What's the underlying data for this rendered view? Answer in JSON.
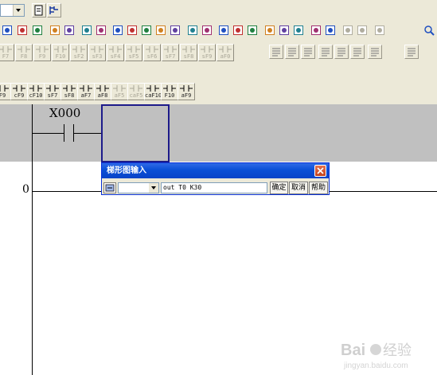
{
  "toolbar": {
    "row1_icons": [
      "combo-box",
      "select-icon",
      "monitor-icon"
    ],
    "fkeys_row2": [
      {
        "cap": "F7",
        "enabled": false
      },
      {
        "cap": "F8",
        "enabled": false
      },
      {
        "cap": "F9",
        "enabled": false
      },
      {
        "cap": "F10",
        "enabled": false
      },
      {
        "cap": "sF2",
        "enabled": false
      },
      {
        "cap": "sF3",
        "enabled": false
      },
      {
        "cap": "sF4",
        "enabled": false
      },
      {
        "cap": "sF5",
        "enabled": false
      },
      {
        "cap": "sF6",
        "enabled": false
      },
      {
        "cap": "sF7",
        "enabled": false
      },
      {
        "cap": "sF8",
        "enabled": false
      },
      {
        "cap": "sF9",
        "enabled": false
      },
      {
        "cap": "aF0",
        "enabled": false
      }
    ],
    "fkeys_row3": [
      {
        "cap": "F9",
        "enabled": true
      },
      {
        "cap": "cF9",
        "enabled": true
      },
      {
        "cap": "cF10",
        "enabled": true
      },
      {
        "cap": "sF7",
        "enabled": true
      },
      {
        "cap": "sF8",
        "enabled": true
      },
      {
        "cap": "aF7",
        "enabled": true
      },
      {
        "cap": "aF8",
        "enabled": true
      },
      {
        "cap": "aF5",
        "enabled": false
      },
      {
        "cap": "caF5",
        "enabled": false
      },
      {
        "cap": "caF10",
        "enabled": true
      },
      {
        "cap": "F10",
        "enabled": true
      },
      {
        "cap": "aF9",
        "enabled": true
      }
    ]
  },
  "ladder": {
    "contact_label": "X000",
    "rung_number": "0"
  },
  "dialog": {
    "title": "梯形图输入",
    "instruction_value": "out T0 K30",
    "ok_label": "确定",
    "cancel_label": "取消",
    "help_label": "帮助"
  },
  "watermark": {
    "text": "Baidu经验",
    "subtext": "jingyan.baidu.com"
  },
  "colors": {
    "toolbar_bg": "#ece9d8",
    "ladder_bg": "#c0c0c0",
    "cursor": "#1d1b8a",
    "title_bar": "#0a4fd6"
  }
}
